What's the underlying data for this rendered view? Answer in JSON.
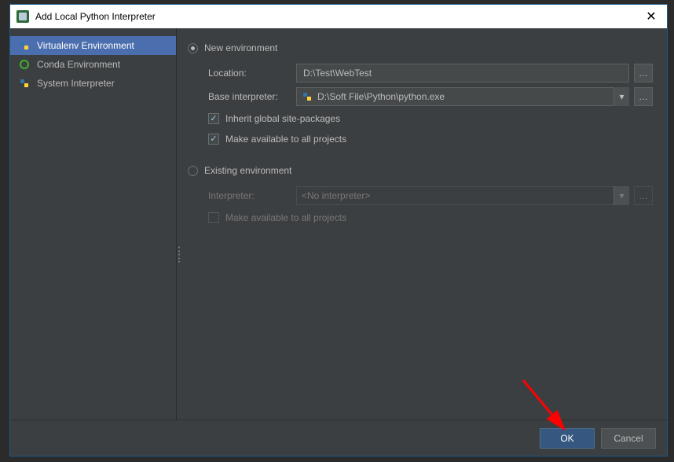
{
  "titlebar": {
    "title": "Add Local Python Interpreter",
    "close": "✕"
  },
  "sidebar": {
    "items": [
      {
        "label": "Virtualenv Environment",
        "selected": true
      },
      {
        "label": "Conda Environment",
        "selected": false
      },
      {
        "label": "System Interpreter",
        "selected": false
      }
    ]
  },
  "form": {
    "new_env_label": "New environment",
    "location_label": "Location:",
    "location_value": "D:\\Test\\WebTest",
    "base_interp_label": "Base interpreter:",
    "base_interp_value": "D:\\Soft File\\Python\\python.exe",
    "inherit_label": "Inherit global site-packages",
    "inherit_checked": true,
    "avail_all_label": "Make available to all projects",
    "avail_all_checked": true,
    "existing_env_label": "Existing environment",
    "interpreter_label": "Interpreter:",
    "interpreter_value": "<No interpreter>",
    "avail_all_existing_label": "Make available to all projects",
    "browse_glyph": "…",
    "dropdown_glyph": "▾"
  },
  "footer": {
    "ok": "OK",
    "cancel": "Cancel"
  }
}
